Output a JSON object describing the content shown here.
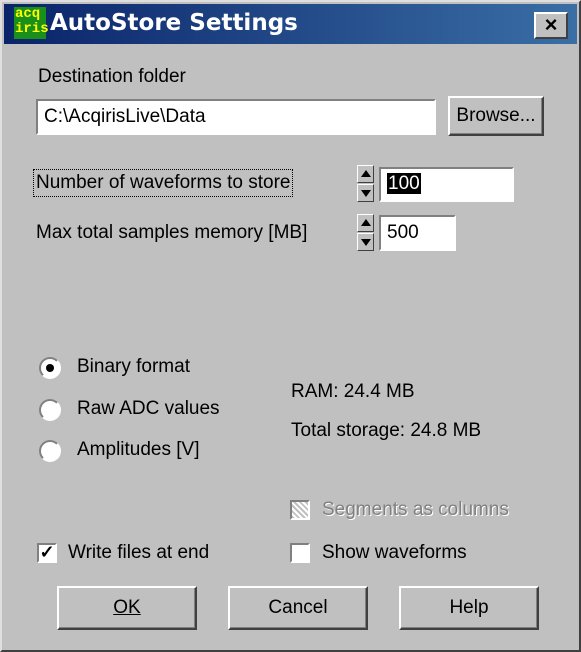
{
  "window": {
    "icon_text_top": "acq",
    "icon_text_bottom": "iris",
    "title": "AutoStore Settings",
    "close_label": "×"
  },
  "destination": {
    "label": "Destination folder",
    "path_value": "C:\\AcqirisLive\\Data",
    "browse_label": "Browse..."
  },
  "waveforms": {
    "label": "Number of waveforms to store",
    "value": "100"
  },
  "memory": {
    "label": "Max total samples memory [MB]",
    "value": "500"
  },
  "format": {
    "options": [
      {
        "label": "Binary format",
        "selected": true
      },
      {
        "label": "Raw ADC values",
        "selected": false
      },
      {
        "label": "Amplitudes [V]",
        "selected": false
      }
    ]
  },
  "info": {
    "ram": "RAM: 24.4 MB",
    "total_storage": "Total storage: 24.8 MB"
  },
  "options": {
    "segments_as_columns": {
      "label": "Segments as columns",
      "checked": false,
      "enabled": false
    },
    "write_files_at_end": {
      "label": "Write files at end",
      "checked": true
    },
    "show_waveforms": {
      "label": "Show waveforms",
      "checked": false
    }
  },
  "buttons": {
    "ok_label": "OK",
    "cancel_label": "Cancel",
    "help_label": "Help"
  }
}
